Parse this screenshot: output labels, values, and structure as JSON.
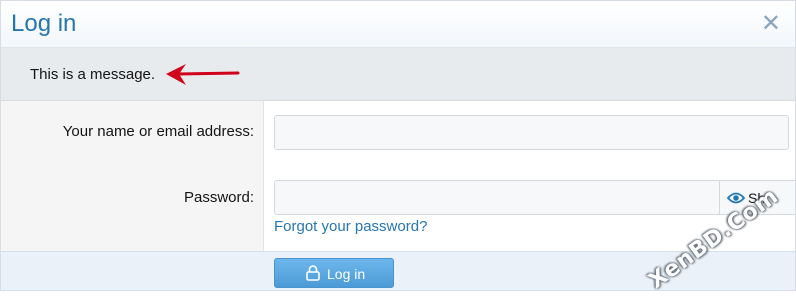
{
  "dialog": {
    "title": "Log in",
    "close_glyph": "✕"
  },
  "message": {
    "text": "This is a message."
  },
  "form": {
    "name_label": "Your name or email address:",
    "name_value": "",
    "password_label": "Password:",
    "password_value": "",
    "show_label": "Sh",
    "forgot_link": "Forgot your password?"
  },
  "footer": {
    "login_label": "Log in"
  },
  "watermark": {
    "text": "XenBD.Com"
  },
  "icons": {
    "close": "close-icon",
    "arrow": "arrow-left-icon",
    "eye": "eye-icon",
    "lock": "lock-icon"
  },
  "colors": {
    "title": "#2577b1",
    "link": "#2577b1",
    "button": "#5aa7e0",
    "arrow": "#d0021b",
    "message_bg": "#e8ebee"
  }
}
